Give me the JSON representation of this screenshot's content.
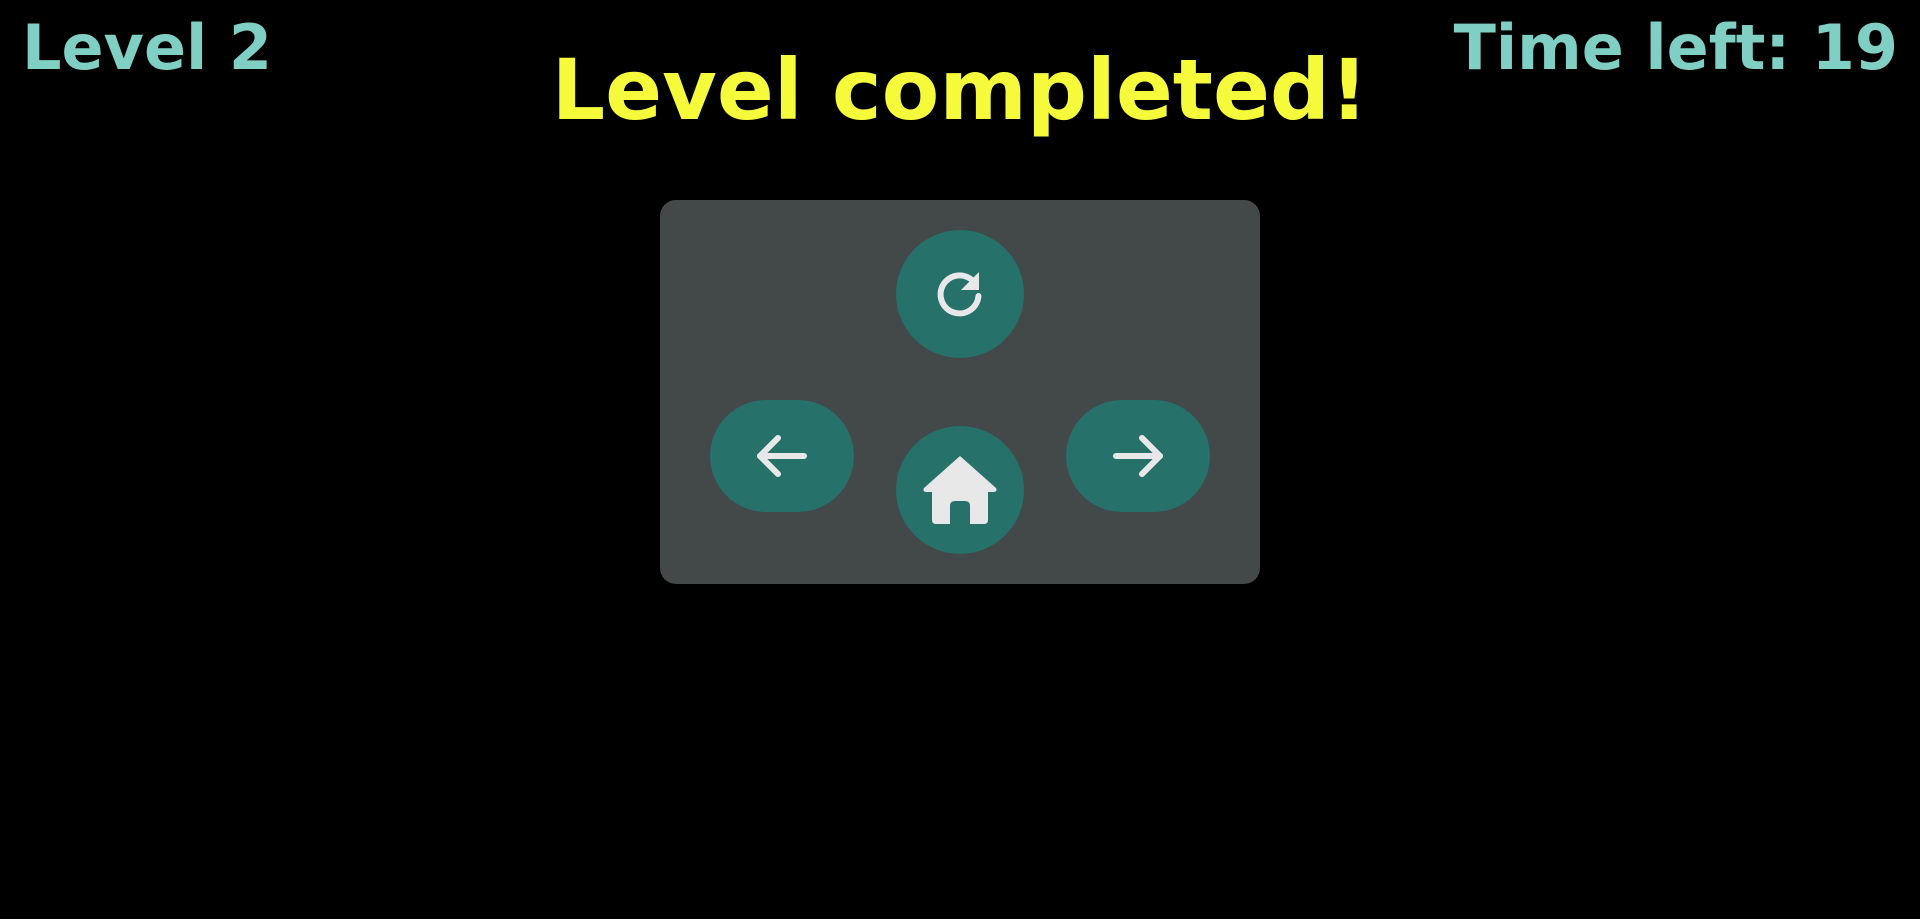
{
  "hud": {
    "level_text": "Level 2",
    "time_text": "Time left: 19"
  },
  "banner": {
    "title": "Level completed!"
  },
  "menu": {
    "buttons": [
      {
        "id": "restart",
        "icon": "restart-icon"
      },
      {
        "id": "previous",
        "icon": "arrow-left-icon"
      },
      {
        "id": "home",
        "icon": "home-icon"
      },
      {
        "id": "next",
        "icon": "arrow-right-icon"
      }
    ]
  },
  "colors": {
    "background": "#000000",
    "hud_text": "#7fcfc4",
    "banner_text": "#f5fb3a",
    "panel": "#434849",
    "button": "#26716a",
    "icon": "#e8e8e8"
  }
}
